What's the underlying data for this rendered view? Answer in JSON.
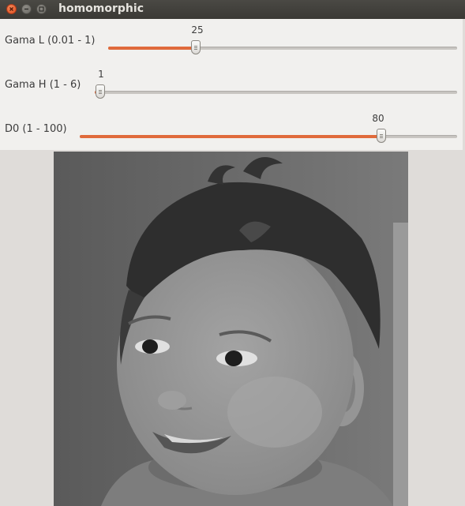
{
  "window": {
    "title": "homomorphic"
  },
  "sliders": [
    {
      "label": "Gama L (0.01 - 1)",
      "value": "25",
      "min": 1,
      "max": 100,
      "level": 0.25
    },
    {
      "label": "Gama H (1 - 6)",
      "value": "1",
      "min": 1,
      "max": 6,
      "level": 0.0
    },
    {
      "label": "D0 (1 - 100)",
      "value": "80",
      "min": 1,
      "max": 100,
      "level": 0.8
    }
  ],
  "colors": {
    "accent": "#e06a3b",
    "titlebar": "#3c3b37",
    "panel": "#f1f0ee",
    "close_button": "#df4b1b"
  },
  "image": {
    "subject": "grayscale photo of smiling toddler with curly dark hair"
  }
}
